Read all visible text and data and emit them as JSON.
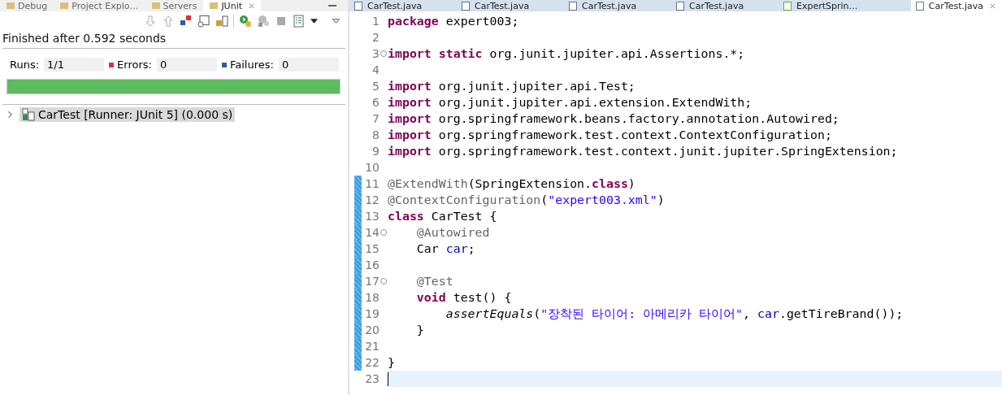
{
  "left_tabs": [
    {
      "label": "Debug",
      "selected": false
    },
    {
      "label": "Project Explo…",
      "selected": false
    },
    {
      "label": "Servers",
      "selected": false
    },
    {
      "label": "JUnit",
      "selected": true
    }
  ],
  "junit": {
    "status": "Finished after 0.592 seconds",
    "counters": [
      {
        "kind": "runs",
        "label": "Runs:",
        "value": "1/1"
      },
      {
        "kind": "errors",
        "label": "Errors:",
        "value": "0"
      },
      {
        "kind": "failures",
        "label": "Failures:",
        "value": "0"
      }
    ],
    "progress": {
      "level": 1
    },
    "tree": [
      {
        "label": "CarTest [Runner: JUnit 5] (0.000 s)",
        "expanded": false,
        "selected": true
      }
    ]
  },
  "editor_tabs": [
    {
      "label": "CarTest.java",
      "kind": "java",
      "selected": false
    },
    {
      "label": "CarTest.java",
      "kind": "java",
      "selected": false
    },
    {
      "label": "CarTest.java",
      "kind": "java",
      "selected": false
    },
    {
      "label": "CarTest.java",
      "kind": "java",
      "selected": false
    },
    {
      "label": "ExpertSprin…",
      "kind": "xml",
      "selected": false
    },
    {
      "label": "CarTest.java",
      "kind": "java",
      "selected": true
    }
  ],
  "code": [
    {
      "number": "1",
      "fold": false,
      "changed": false,
      "current": false,
      "tokens": [
        {
          "kind": "keyword",
          "text": "package"
        },
        {
          "kind": "plain",
          "text": " expert003;"
        }
      ]
    },
    {
      "number": "2",
      "fold": false,
      "changed": false,
      "current": false
    },
    {
      "number": "3",
      "fold": true,
      "changed": false,
      "current": false,
      "tokens": [
        {
          "kind": "keyword",
          "text": "import"
        },
        {
          "kind": "keyword",
          "text": " static"
        },
        {
          "kind": "plain",
          "text": " org.junit.jupiter.api.Assertions.*;"
        }
      ]
    },
    {
      "number": "4",
      "fold": false,
      "changed": false,
      "current": false
    },
    {
      "number": "5",
      "fold": false,
      "changed": false,
      "current": false,
      "tokens": [
        {
          "kind": "keyword",
          "text": "import"
        },
        {
          "kind": "plain",
          "text": " org.junit.jupiter.api.Test;"
        }
      ]
    },
    {
      "number": "6",
      "fold": false,
      "changed": false,
      "current": false,
      "tokens": [
        {
          "kind": "keyword",
          "text": "import"
        },
        {
          "kind": "plain",
          "text": " org.junit.jupiter.api.extension.ExtendWith;"
        }
      ]
    },
    {
      "number": "7",
      "fold": false,
      "changed": false,
      "current": false,
      "tokens": [
        {
          "kind": "keyword",
          "text": "import"
        },
        {
          "kind": "plain",
          "text": " org.springframework.beans.factory.annotation.Autowired;"
        }
      ]
    },
    {
      "number": "8",
      "fold": false,
      "changed": false,
      "current": false,
      "tokens": [
        {
          "kind": "keyword",
          "text": "import"
        },
        {
          "kind": "plain",
          "text": " org.springframework.test.context.ContextConfiguration;"
        }
      ]
    },
    {
      "number": "9",
      "fold": false,
      "changed": false,
      "current": false,
      "tokens": [
        {
          "kind": "keyword",
          "text": "import"
        },
        {
          "kind": "plain",
          "text": " org.springframework.test.context.junit.jupiter.SpringExtension;"
        }
      ]
    },
    {
      "number": "10",
      "fold": false,
      "changed": false,
      "current": false
    },
    {
      "number": "11",
      "fold": false,
      "changed": true,
      "current": false,
      "tokens": [
        {
          "kind": "annotation",
          "text": "@ExtendWith"
        },
        {
          "kind": "plain",
          "text": "(SpringExtension."
        },
        {
          "kind": "keyword",
          "text": "class"
        },
        {
          "kind": "plain",
          "text": ")"
        }
      ]
    },
    {
      "number": "12",
      "fold": false,
      "changed": true,
      "current": false,
      "tokens": [
        {
          "kind": "annotation",
          "text": "@ContextConfiguration"
        },
        {
          "kind": "plain",
          "text": "("
        },
        {
          "kind": "string",
          "text": "\"expert003.xml\""
        },
        {
          "kind": "plain",
          "text": ")"
        }
      ]
    },
    {
      "number": "13",
      "fold": false,
      "changed": true,
      "current": false,
      "tokens": [
        {
          "kind": "keyword",
          "text": "class"
        },
        {
          "kind": "plain",
          "text": " CarTest {"
        }
      ]
    },
    {
      "number": "14",
      "fold": true,
      "changed": true,
      "current": false,
      "tokens": [
        {
          "kind": "annotation",
          "text": "    @Autowired"
        }
      ]
    },
    {
      "number": "15",
      "fold": false,
      "changed": true,
      "current": false,
      "tokens": [
        {
          "kind": "plain",
          "text": "    Car "
        },
        {
          "kind": "field",
          "text": "car"
        },
        {
          "kind": "plain",
          "text": ";"
        }
      ]
    },
    {
      "number": "16",
      "fold": false,
      "changed": true,
      "current": false
    },
    {
      "number": "17",
      "fold": true,
      "changed": true,
      "current": false,
      "tokens": [
        {
          "kind": "annotation",
          "text": "    @Test"
        }
      ]
    },
    {
      "number": "18",
      "fold": false,
      "changed": true,
      "current": false,
      "tokens": [
        {
          "kind": "keyword",
          "text": "    void"
        },
        {
          "kind": "plain",
          "text": " test() {"
        }
      ]
    },
    {
      "number": "19",
      "fold": false,
      "changed": true,
      "current": false,
      "tokens": [
        {
          "kind": "static",
          "text": "        assertEquals"
        },
        {
          "kind": "plain",
          "text": "("
        },
        {
          "kind": "string",
          "text": "\"장착된 타이어: 아메리카 타이어\""
        },
        {
          "kind": "plain",
          "text": ", "
        },
        {
          "kind": "field",
          "text": "car"
        },
        {
          "kind": "plain",
          "text": ".getTireBrand());"
        }
      ]
    },
    {
      "number": "20",
      "fold": false,
      "changed": true,
      "current": false,
      "tokens": [
        {
          "kind": "plain",
          "text": "    }"
        }
      ]
    },
    {
      "number": "21",
      "fold": false,
      "changed": true,
      "current": false
    },
    {
      "number": "22",
      "fold": false,
      "changed": true,
      "current": false,
      "tokens": [
        {
          "kind": "plain",
          "text": "}"
        }
      ]
    },
    {
      "number": "23",
      "fold": false,
      "changed": false,
      "current": true
    }
  ]
}
